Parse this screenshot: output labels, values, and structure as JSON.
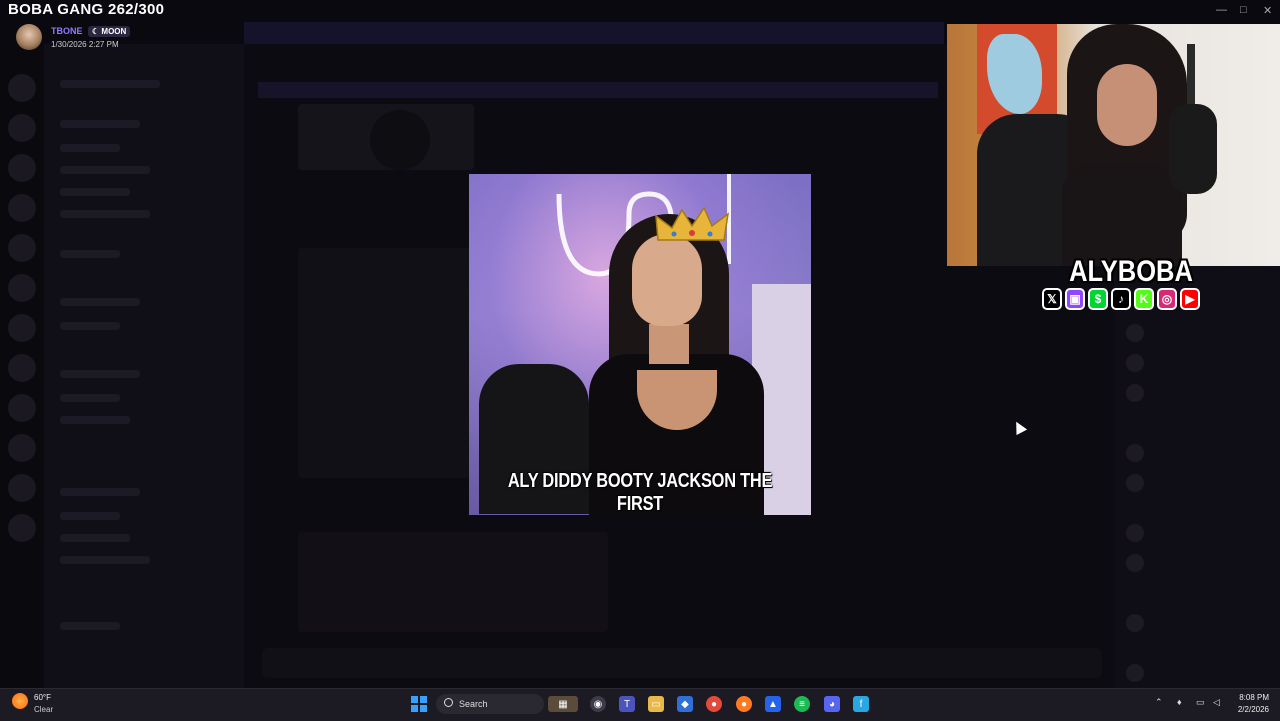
{
  "overlay": {
    "goal_title": "BOBA GANG 262/300",
    "username": "TBONE",
    "badge": "MOON",
    "date": "1/30/2026 2:27 PM",
    "caption": "ALY DIDDY BOOTY JACKSON THE FIRST",
    "streamer_name": "ALYBOBA",
    "socials": [
      {
        "icon": "x-icon",
        "glyph": "𝕏",
        "color": "#000000"
      },
      {
        "icon": "twitch-icon",
        "glyph": "▣",
        "color": "#9146ff"
      },
      {
        "icon": "cashapp-icon",
        "glyph": "$",
        "color": "#00d632"
      },
      {
        "icon": "tiktok-icon",
        "glyph": "♪",
        "color": "#000000"
      },
      {
        "icon": "kick-icon",
        "glyph": "K",
        "color": "#53fc18"
      },
      {
        "icon": "instagram-icon",
        "glyph": "◎",
        "color": "#d62976"
      },
      {
        "icon": "youtube-icon",
        "glyph": "▶",
        "color": "#ff0000"
      }
    ]
  },
  "window_controls": {
    "minimize": "—",
    "maximize": "□",
    "close": "✕"
  },
  "taskbar": {
    "temperature": "60°F",
    "condition": "Clear",
    "search_label": "Search",
    "time": "8:08 PM",
    "date": "2/2/2026",
    "apps": [
      "start-icon",
      "copilot-icon",
      "teams-icon",
      "file-explorer-icon",
      "office-icon",
      "chrome-icon",
      "firefox-icon",
      "edge-icon",
      "spotify-icon",
      "discord-icon",
      "notes-icon"
    ],
    "tray_icons": [
      "chevron-up-icon",
      "microphone-icon",
      "network-icon",
      "volume-icon"
    ]
  }
}
